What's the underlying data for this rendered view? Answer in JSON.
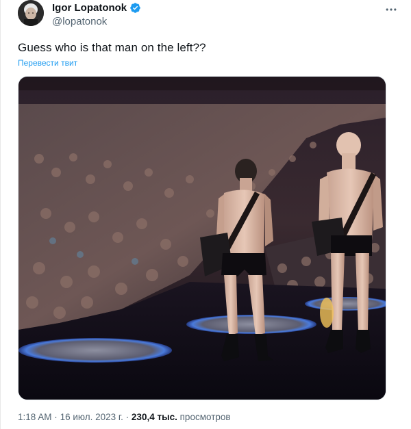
{
  "author": {
    "display_name": "Igor Lopatonok",
    "handle": "@lopatonok"
  },
  "tweet": {
    "text": "Guess who is that man on the left??",
    "translate_label": "Перевести твит"
  },
  "meta": {
    "time": "1:18 AM",
    "separator": "·",
    "date": "16 июл. 2023 г.",
    "separator2": "·",
    "views_count": "230,4 тыс.",
    "views_label": "просмотров"
  },
  "colors": {
    "accent": "#1d9bf0",
    "text_primary": "#0f1419",
    "text_secondary": "#536471"
  },
  "icons": {
    "verified": "verified-badge-icon",
    "more": "more-dots-icon"
  }
}
